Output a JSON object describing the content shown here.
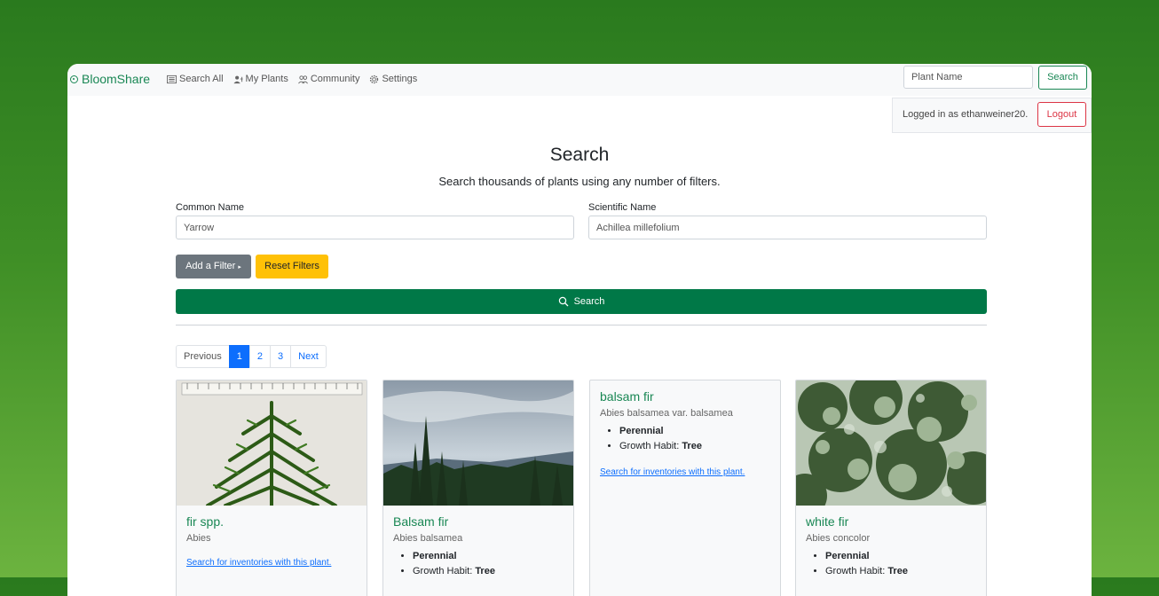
{
  "navbar": {
    "brand": "BloomShare",
    "links": [
      {
        "label": "Search All",
        "icon": "list-icon"
      },
      {
        "label": "My Plants",
        "icon": "user-plant-icon"
      },
      {
        "label": "Community",
        "icon": "people-icon"
      },
      {
        "label": "Settings",
        "icon": "gear-icon"
      }
    ],
    "search_placeholder": "Plant Name",
    "search_button": "Search"
  },
  "login": {
    "text": "Logged in as ethanweiner20.",
    "logout": "Logout"
  },
  "page": {
    "title": "Search",
    "subtitle": "Search thousands of plants using any number of filters."
  },
  "form": {
    "common_name": {
      "label": "Common Name",
      "value": "Yarrow"
    },
    "scientific_name": {
      "label": "Scientific Name",
      "value": "Achillea millefolium"
    },
    "add_filter": "Add a Filter",
    "add_filter_caret": "▸",
    "reset": "Reset Filters",
    "search": "Search"
  },
  "pagination": {
    "previous": "Previous",
    "pages": [
      "1",
      "2",
      "3"
    ],
    "active": "1",
    "next": "Next"
  },
  "cards": [
    {
      "name": "fir spp.",
      "scientific": "Abies",
      "link": "Search for inventories with this plant.",
      "image": "fir-branch-specimen"
    },
    {
      "name": "Balsam fir",
      "scientific": "Abies balsamea",
      "duration": "Perennial",
      "growth_label": "Growth Habit: ",
      "growth": "Tree",
      "image": "fir-forest-landscape"
    },
    {
      "name": "balsam fir",
      "scientific": "Abies balsamea var. balsamea",
      "duration": "Perennial",
      "growth_label": "Growth Habit: ",
      "growth": "Tree",
      "link": "Search for inventories with this plant."
    },
    {
      "name": "white fir",
      "scientific": "Abies concolor",
      "duration": "Perennial",
      "growth_label": "Growth Habit: ",
      "growth": "Tree",
      "image": "white-fir-foliage"
    }
  ],
  "colors": {
    "brand_green": "#198754",
    "search_green": "#007847",
    "reset_yellow": "#ffc107",
    "filter_gray": "#6c757d",
    "link_blue": "#0d6efd",
    "logout_red": "#dc3545"
  }
}
